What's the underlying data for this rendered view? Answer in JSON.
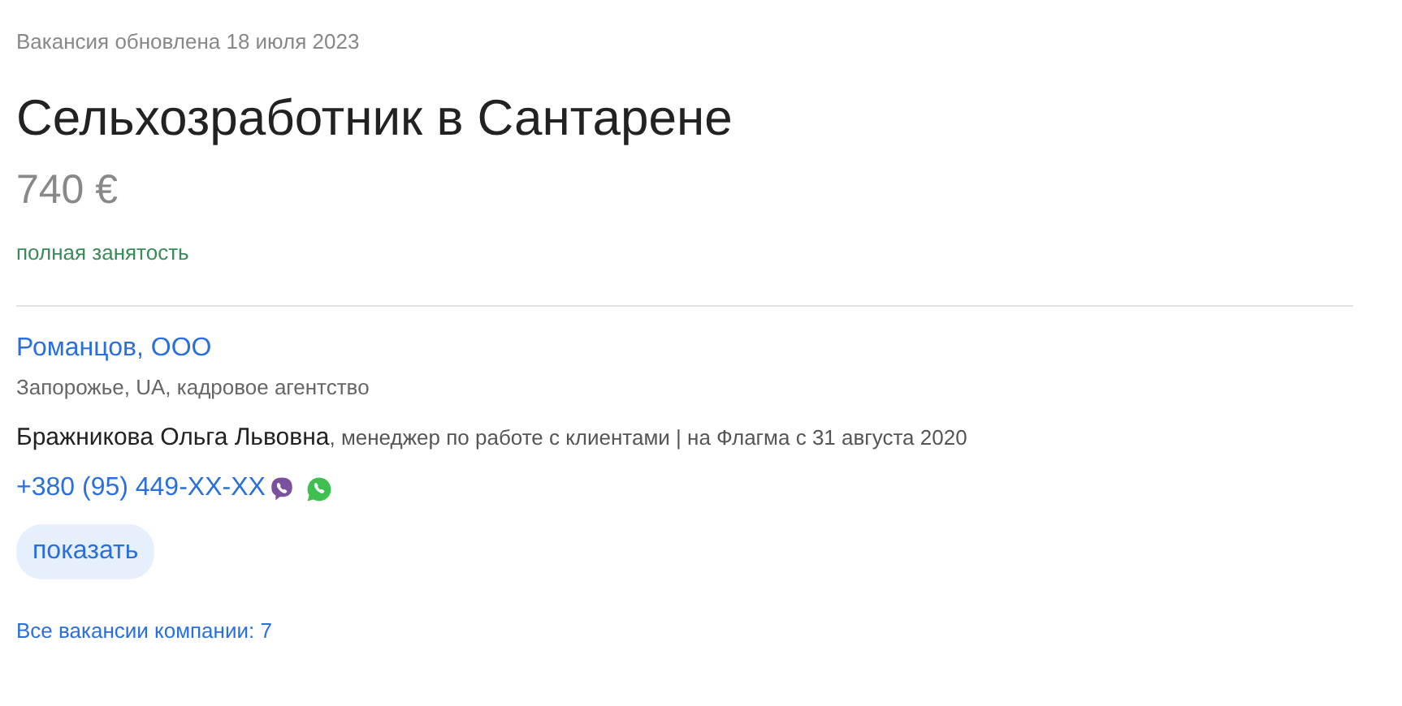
{
  "updated": "Вакансия обновлена 18 июля 2023",
  "title": "Сельхозработник в Сантарене",
  "salary": "740 €",
  "employment": "полная занятость",
  "company": {
    "name": "Романцов, ООО",
    "details": "Запорожье, UA, кадровое агентство"
  },
  "contact": {
    "name": "Бражникова Ольга Львовна",
    "role": ", менеджер по работе с клиентами | на Флагма с 31 августа 2020",
    "phone": "+380 (95) 449-XX-XX",
    "messengers": [
      {
        "kind": "viber"
      },
      {
        "kind": "whatsapp"
      }
    ]
  },
  "show_button": "показать",
  "all_vacancies": "Все вакансии компании: 7"
}
